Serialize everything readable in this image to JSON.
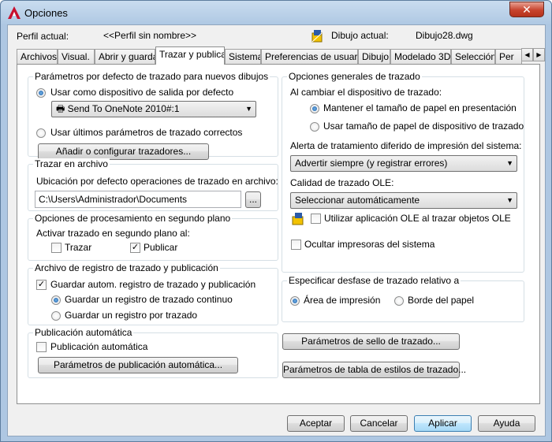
{
  "window": {
    "title": "Opciones"
  },
  "profile": {
    "current_label": "Perfil actual:",
    "current_value": "<<Perfil sin nombre>>",
    "drawing_label": "Dibujo actual:",
    "drawing_value": "Dibujo28.dwg"
  },
  "tabs": [
    {
      "label": "Archivos"
    },
    {
      "label": "Visual."
    },
    {
      "label": "Abrir y guardar"
    },
    {
      "label": "Trazar y publicar",
      "active": true
    },
    {
      "label": "Sistema"
    },
    {
      "label": "Preferencias de usuario"
    },
    {
      "label": "Dibujo"
    },
    {
      "label": "Modelado 3D"
    },
    {
      "label": "Selección"
    },
    {
      "label": "Per"
    }
  ],
  "default_params": {
    "title": "Parámetros por defecto de trazado para nuevos dibujos",
    "use_device_label": "Usar como dispositivo de salida por defecto",
    "device_value": "Send To OneNote 2010#:1",
    "use_last_label": "Usar últimos parámetros de trazado correctos",
    "add_button": "Añadir o configurar trazadores..."
  },
  "plot_to_file": {
    "title": "Trazar en archivo",
    "location_label": "Ubicación por defecto operaciones de trazado en archivo:",
    "location_value": "C:\\Users\\Administrador\\Documents",
    "browse_label": "..."
  },
  "background": {
    "title": "Opciones de procesamiento en segundo plano",
    "enable_label": "Activar trazado en segundo plano al:",
    "plot_label": "Trazar",
    "plot_checked": false,
    "publish_label": "Publicar",
    "publish_checked": true
  },
  "log": {
    "title": "Archivo de registro de trazado y publicación",
    "auto_save_label": "Guardar autom. registro de trazado y publicación",
    "auto_save_checked": true,
    "continuous_label": "Guardar un registro de trazado continuo",
    "per_plot_label": "Guardar un registro por trazado"
  },
  "auto_publish": {
    "title": "Publicación automática",
    "check_label": "Publicación automática",
    "checked": false,
    "settings_button": "Parámetros de publicación automática..."
  },
  "general": {
    "title": "Opciones generales de trazado",
    "when_changing_label": "Al cambiar el dispositivo de trazado:",
    "keep_paper_label": "Mantener el tamaño de papel en presentación",
    "use_device_paper_label": "Usar tamaño de papel de dispositivo de trazado",
    "spool_alert_label": "Alerta de tratamiento diferido de impresión del sistema:",
    "spool_alert_value": "Advertir siempre (y registrar errores)",
    "ole_quality_label": "Calidad de trazado OLE:",
    "ole_quality_value": "Seleccionar automáticamente",
    "use_ole_app_label": "Utilizar aplicación OLE al trazar objetos OLE",
    "use_ole_app_checked": false,
    "hide_printers_label": "Ocultar impresoras del sistema",
    "hide_printers_checked": false
  },
  "offset": {
    "title": "Especificar desfase de trazado relativo a",
    "printable_label": "Área de impresión",
    "edge_label": "Borde del papel"
  },
  "stamp_button": "Parámetros de sello de trazado...",
  "styles_button": "Parámetros de tabla de estilos de trazado...",
  "footer": {
    "ok": "Aceptar",
    "cancel": "Cancelar",
    "apply": "Aplicar",
    "help": "Ayuda"
  }
}
